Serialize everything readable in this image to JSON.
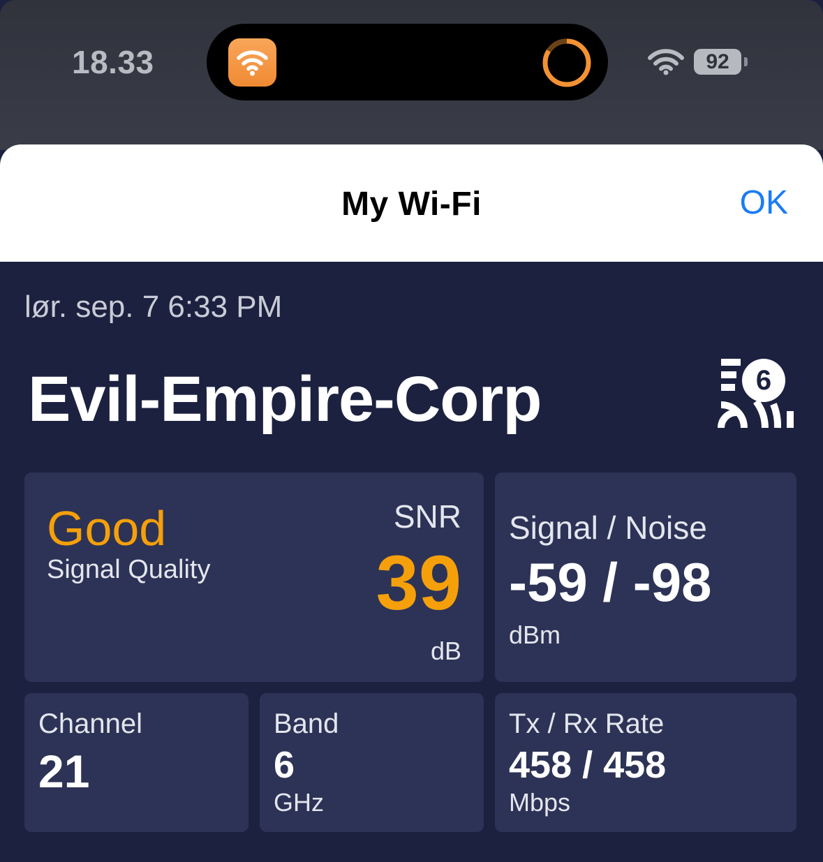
{
  "status_bar": {
    "time": "18.33",
    "battery": "92",
    "accent": "#f39233"
  },
  "sheet": {
    "title": "My Wi-Fi",
    "ok_label": "OK"
  },
  "wifi": {
    "date": "lør. sep. 7 6:33 PM",
    "ssid": "Evil-Empire-Corp",
    "generation_badge": "6",
    "signal_quality": {
      "rating": "Good",
      "label": "Signal Quality",
      "snr_label": "SNR",
      "snr_value": "39",
      "snr_unit": "dB"
    },
    "signal_noise": {
      "label": "Signal / Noise",
      "value": "-59 / -98",
      "unit": "dBm"
    },
    "channel": {
      "label": "Channel",
      "value": "21"
    },
    "band": {
      "label": "Band",
      "value": "6",
      "unit": "GHz"
    },
    "rate": {
      "label": "Tx / Rx Rate",
      "value": "458 / 458",
      "unit": "Mbps"
    }
  },
  "colors": {
    "background": "#1c2140",
    "card": "#2d3356",
    "highlight": "#f5a00a",
    "link": "#1a7cf5"
  }
}
